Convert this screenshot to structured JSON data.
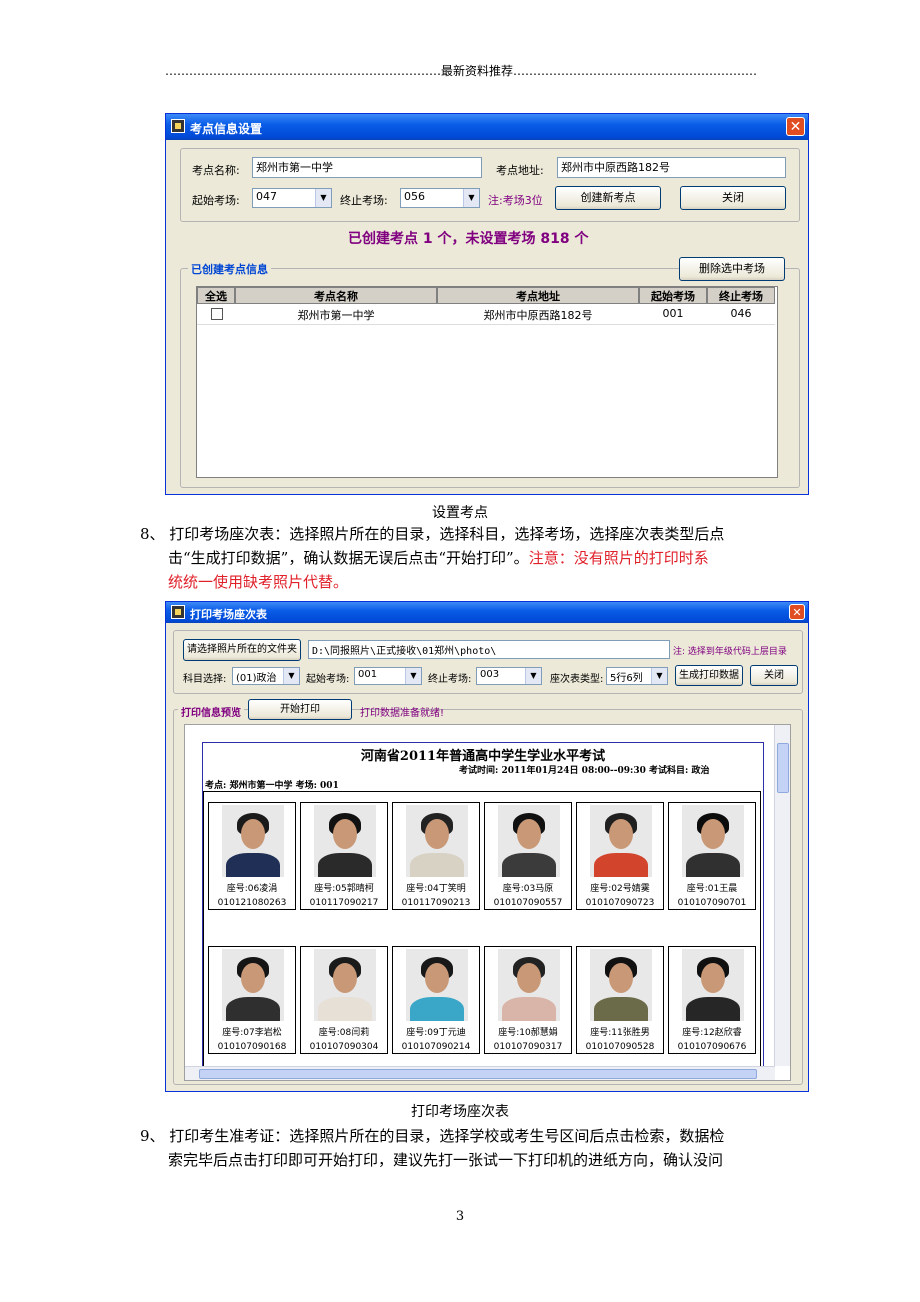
{
  "header": {
    "text": "……………………………………………………………最新资料推荐………………………………………………………"
  },
  "window1": {
    "title": "考点信息设置",
    "close_glyph": "✕",
    "fields": {
      "name_label": "考点名称:",
      "name_value": "郑州市第一中学",
      "address_label": "考点地址:",
      "address_value": "郑州市中原西路182号",
      "start_label": "起始考场:",
      "start_value": "047",
      "end_label": "终止考场:",
      "end_value": "056",
      "note": "注:考场3位",
      "create_button": "创建新考点",
      "close_button": "关闭"
    },
    "summary": "已创建考点  1  个，未设置考场  818   个",
    "group_label": "已创建考点信息",
    "delete_button": "删除选中考场",
    "table": {
      "headers": [
        "全选",
        "考点名称",
        "考点地址",
        "起始考场",
        "终止考场"
      ],
      "rows": [
        {
          "checked": false,
          "name": "郑州市第一中学",
          "address": "郑州市中原西路182号",
          "start": "001",
          "end": "046"
        }
      ]
    }
  },
  "caption1": "设置考点",
  "para8": {
    "line1": "8、  打印考场座次表：选择照片所在的目录，选择科目，选择考场，选择座次表类型后点",
    "line2": "击“生成打印数据”，确认数据无误后点击“开始打印”。",
    "line2_red": "注意：没有照片的打印时系",
    "line3_red": "统统一使用缺考照片代替。"
  },
  "window2": {
    "title": "打印考场座次表",
    "close_glyph": "✕",
    "folder_button": "请选择照片所在的文件夹",
    "path_value": "D:\\同报照片\\正式接收\\01郑州\\photo\\",
    "path_note": "注: 选择到年级代码上层目录",
    "subject_label": "科目选择:",
    "subject_value": "(01)政治",
    "start_label": "起始考场:",
    "start_value": "001",
    "end_label": "终止考场:",
    "end_value": "003",
    "type_label": "座次表类型:",
    "type_value": "5行6列",
    "generate_button": "生成打印数据",
    "close_button": "关闭",
    "preview_label": "打印信息预览",
    "start_print_button": "开始打印",
    "status": "打印数据准备就绪!",
    "sheet": {
      "title": "河南省2011年普通高中学生学业水平考试",
      "exam_info": "考试时间: 2011年01月24日  08:00--09:30  考试科目: 政治",
      "site_info": "考点: 郑州市第一中学   考场: 001",
      "students": [
        {
          "seat": "座号:06凌涓",
          "id": "010121080263",
          "hair": "#1a1a1a",
          "body": "#1f2f55"
        },
        {
          "seat": "座号:05郭晴柯",
          "id": "010117090217",
          "hair": "#111111",
          "body": "#2a2a2a"
        },
        {
          "seat": "座号:04丁笑明",
          "id": "010117090213",
          "hair": "#222222",
          "body": "#d8d2c4"
        },
        {
          "seat": "座号:03马原",
          "id": "010107090557",
          "hair": "#111111",
          "body": "#3b3b3b"
        },
        {
          "seat": "座号:02号婧霙",
          "id": "010107090723",
          "hair": "#202020",
          "body": "#d2452c"
        },
        {
          "seat": "座号:01王晨",
          "id": "010107090701",
          "hair": "#0c0c0c",
          "body": "#303030"
        },
        {
          "seat": "座号:07李岩松",
          "id": "010107090168",
          "hair": "#151515",
          "body": "#2f2f2f"
        },
        {
          "seat": "座号:08闫莉",
          "id": "010107090304",
          "hair": "#1a1a1a",
          "body": "#e6e0d6"
        },
        {
          "seat": "座号:09丁元迪",
          "id": "010107090214",
          "hair": "#181818",
          "body": "#3aa7c8"
        },
        {
          "seat": "座号:10郝慧娟",
          "id": "010107090317",
          "hair": "#222222",
          "body": "#d9b4a8"
        },
        {
          "seat": "座号:11张胜男",
          "id": "010107090528",
          "hair": "#111111",
          "body": "#6b6b4a"
        },
        {
          "seat": "座号:12赵欣睿",
          "id": "010107090676",
          "hair": "#101010",
          "body": "#262626"
        }
      ]
    }
  },
  "caption2": "打印考场座次表",
  "para9": {
    "line1": "9、  打印考生准考证：选择照片所在的目录，选择学校或考生号区间后点击检索，数据检",
    "line2": "索完毕后点击打印即可开始打印，建议先打一张试一下打印机的进纸方向，确认没问"
  },
  "page_number": "3"
}
